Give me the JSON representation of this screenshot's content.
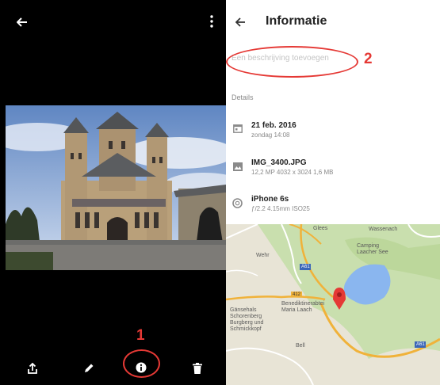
{
  "viewer": {
    "back_icon": "arrow-left-icon",
    "menu_icon": "more-vert-icon",
    "toolbar": {
      "share_icon": "share-icon",
      "edit_icon": "pencil-icon",
      "info_icon": "info-icon",
      "delete_icon": "trash-icon"
    },
    "annotation_1": "1"
  },
  "info": {
    "back_icon": "arrow-left-icon",
    "title": "Informatie",
    "description_placeholder": "Een beschrijving toevoegen",
    "annotation_2": "2",
    "details_header": "Details",
    "date": {
      "icon": "calendar-icon",
      "main": "21 feb. 2016",
      "sub": "zondag 14:08"
    },
    "file": {
      "icon": "image-icon",
      "main": "IMG_3400.JPG",
      "sub": "12,2 MP   4032 x 3024   1,6 MB"
    },
    "camera": {
      "icon": "aperture-icon",
      "main": "iPhone 6s",
      "sub": "ƒ/2.2   4.15mm   ISO25"
    }
  },
  "map": {
    "labels": {
      "glees": "Glees",
      "wassenach": "Wassenach",
      "camping": "Camping Laacher See",
      "wehr": "Wehr",
      "abbey": "Benediktinerabtei Maria Laach",
      "gaensehals": "Gänsehals Schorenberg Burgberg und Schmickkopf",
      "bell": "Bell",
      "road_412": "412",
      "road_a61": "A61"
    },
    "colors": {
      "land": "#e7e4d8",
      "green": "#c9dfae",
      "lake": "#8ab6ef",
      "road": "#f0b23a",
      "pin": "#e53935"
    }
  }
}
